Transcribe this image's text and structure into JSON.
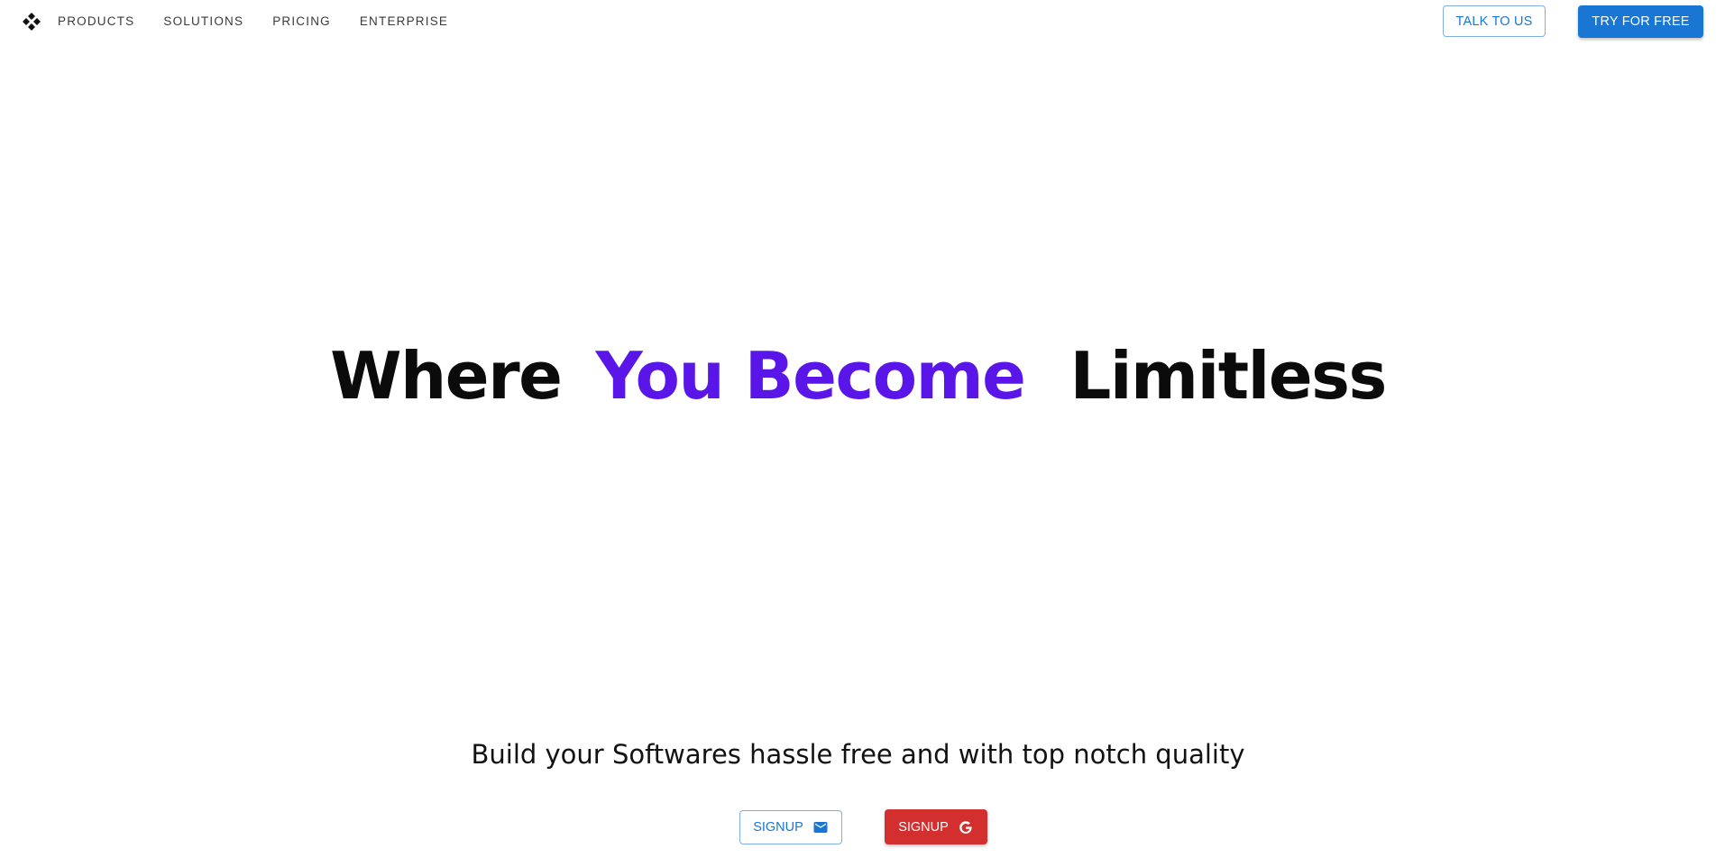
{
  "nav": {
    "logo_icon": "diamond-grid-logo",
    "links": [
      {
        "label": "PRODUCTS"
      },
      {
        "label": "SOLUTIONS"
      },
      {
        "label": "PRICING"
      },
      {
        "label": "ENTERPRISE"
      }
    ],
    "talk_label": "TALK TO US",
    "try_label": "TRY FOR FREE"
  },
  "hero": {
    "part1": "Where",
    "part2": "You Become",
    "part3": "Limitless",
    "accent_color": "#5a16e8",
    "text_color": "#0b0b0b"
  },
  "subhead": {
    "text": "Build your Softwares hassle free and with top notch quality"
  },
  "signup": {
    "email_label": "SIGNUP",
    "email_icon": "mail-icon",
    "google_label": "SIGNUP",
    "google_icon": "google-icon"
  },
  "colors": {
    "primary": "#1976d2",
    "google_red": "#d32f2f"
  }
}
